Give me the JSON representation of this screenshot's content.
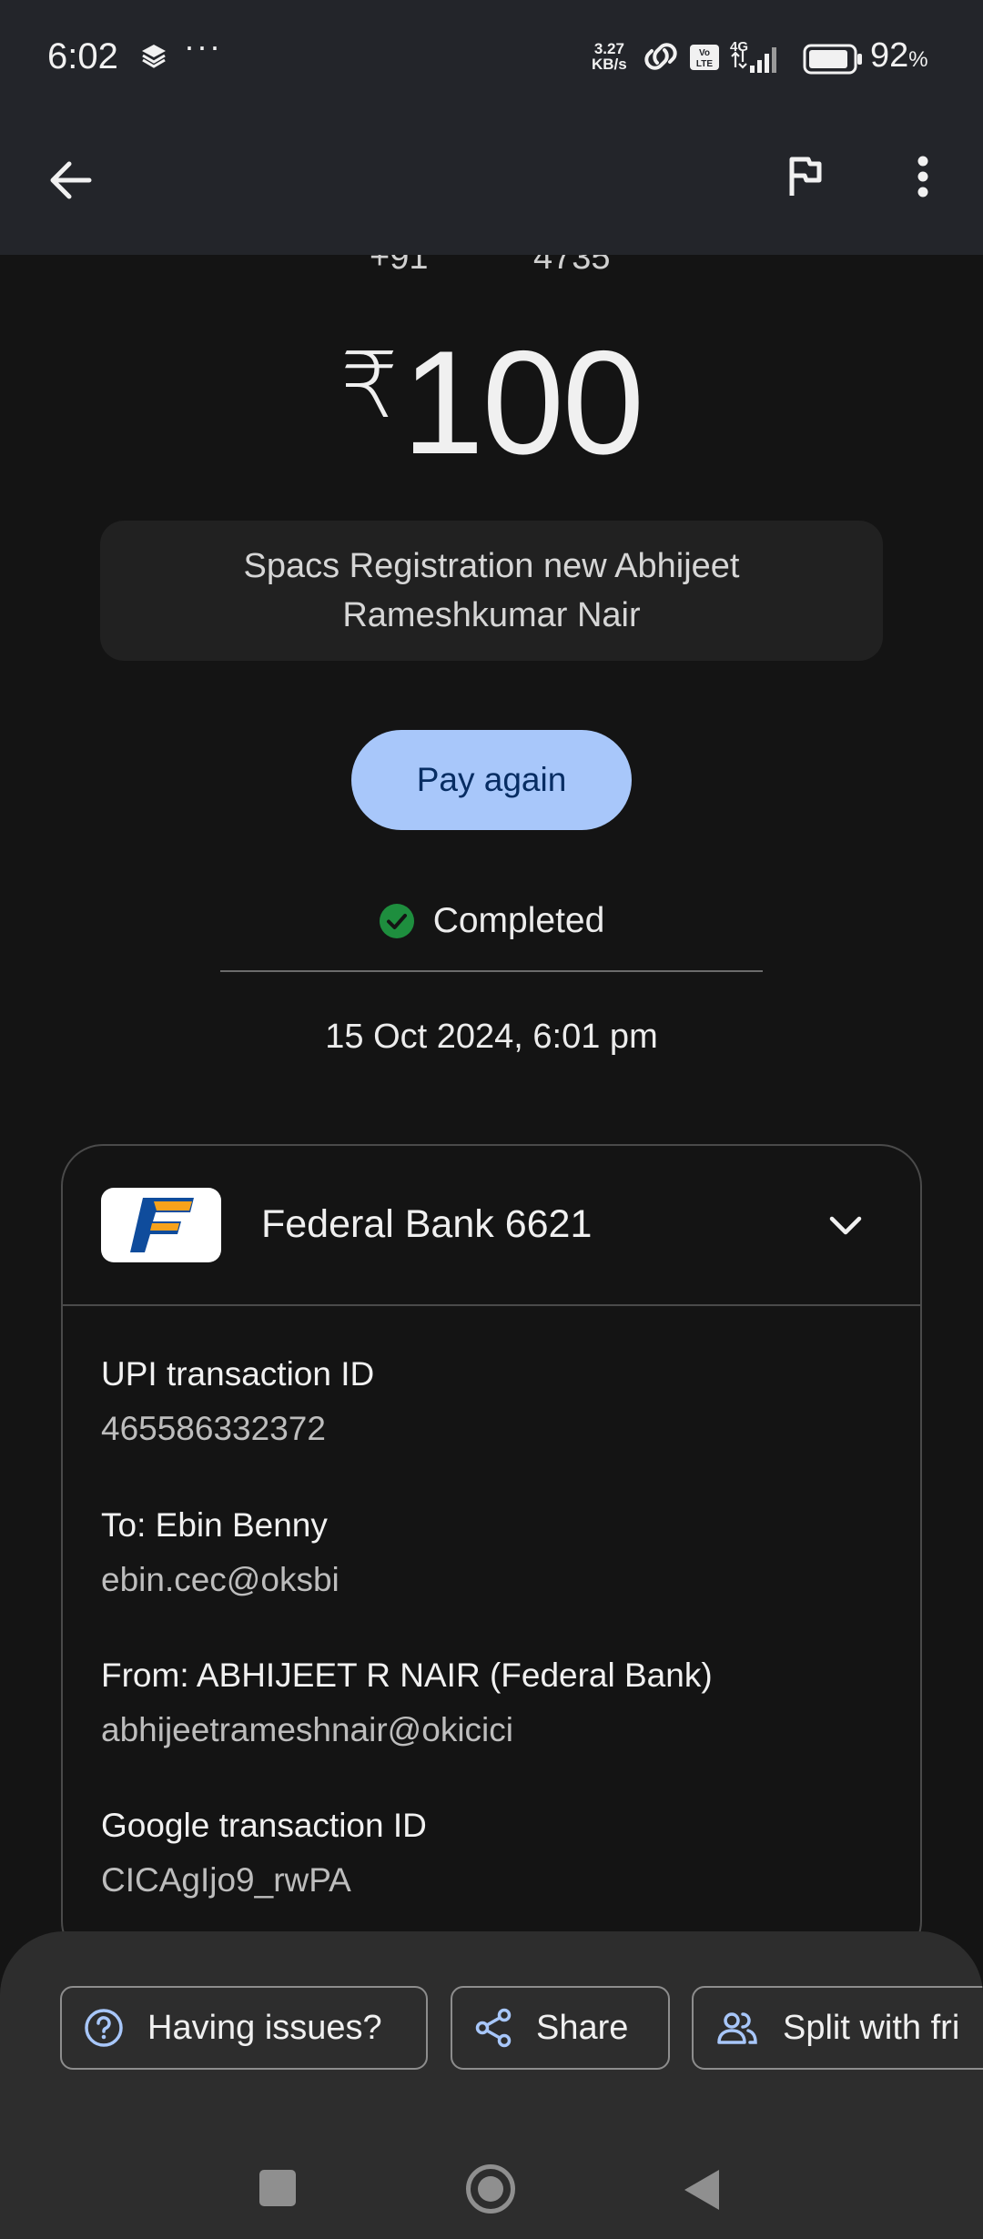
{
  "status_bar": {
    "time": "6:02",
    "more_dots": "···",
    "net_speed_value": "3.27",
    "net_speed_unit": "KB/s",
    "network": "4G",
    "battery_pct": "92",
    "battery_unit": "%",
    "battery_level": 0.92
  },
  "header_peek": {
    "left": "+91",
    "right": "4735"
  },
  "payment": {
    "currency": "₹",
    "amount": "100",
    "note": "Spacs Registration new Abhijeet Rameshkumar Nair",
    "pay_again_label": "Pay again",
    "status": "Completed",
    "datetime": "15 Oct 2024, 6:01 pm"
  },
  "card": {
    "bank_name": "Federal Bank 6621",
    "details": [
      {
        "label": "UPI transaction ID",
        "value": "465586332372"
      },
      {
        "label": "To: Ebin  Benny",
        "value": "ebin.cec@oksbi"
      },
      {
        "label": "From: ABHIJEET R NAIR (Federal Bank)",
        "value": "abhijeetrameshnair@okicici"
      },
      {
        "label": "Google transaction ID",
        "value": "CICAgIjo9_rwPA"
      }
    ]
  },
  "actions": {
    "having_issues": "Having issues?",
    "share": "Share",
    "split": "Split with fri"
  },
  "colors": {
    "background": "#141414",
    "topbar": "#23252a",
    "accent_button": "#a8c7fa",
    "success": "#1e8e3e"
  }
}
